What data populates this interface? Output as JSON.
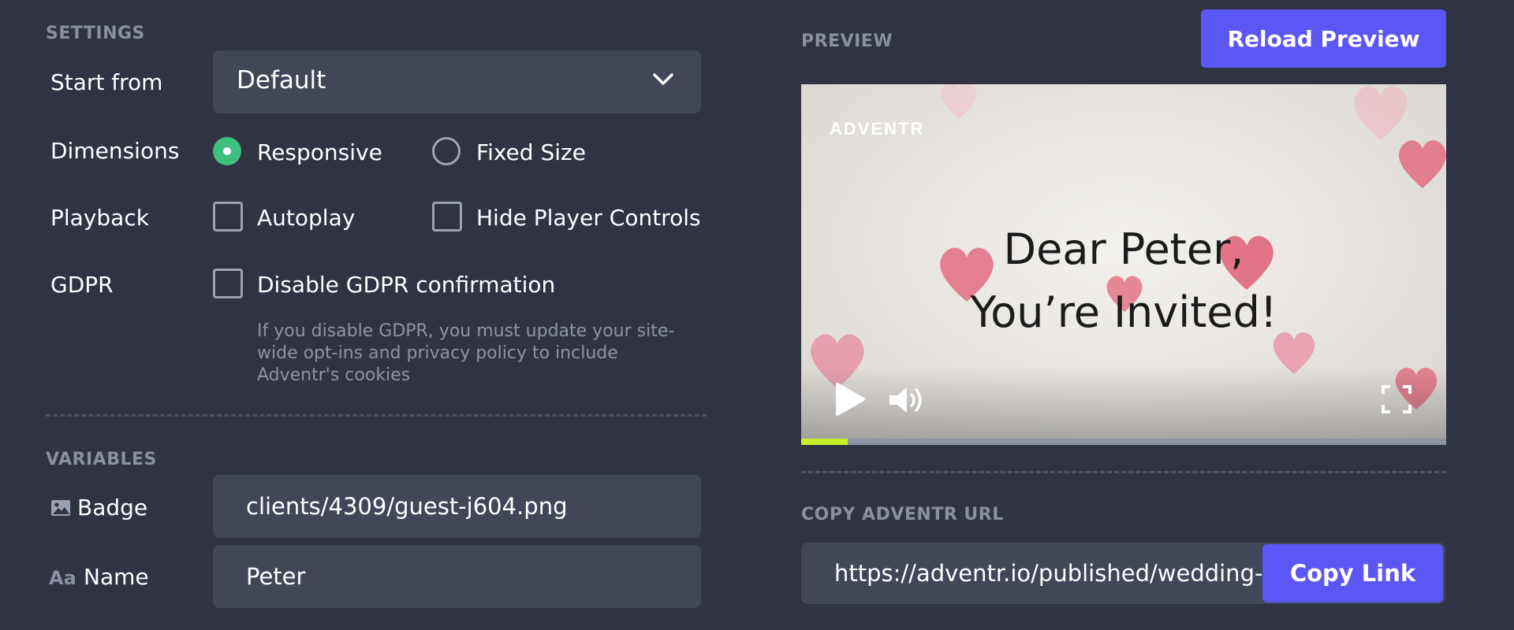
{
  "settings": {
    "title": "SETTINGS",
    "start_from": {
      "label": "Start from",
      "value": "Default"
    },
    "dimensions": {
      "label": "Dimensions",
      "options": [
        {
          "label": "Responsive",
          "selected": true
        },
        {
          "label": "Fixed Size",
          "selected": false
        }
      ]
    },
    "playback": {
      "label": "Playback",
      "options": [
        {
          "label": "Autoplay",
          "checked": false
        },
        {
          "label": "Hide Player Controls",
          "checked": false
        }
      ]
    },
    "gdpr": {
      "label": "GDPR",
      "option": {
        "label": "Disable GDPR confirmation",
        "checked": false
      },
      "note_lines": [
        "If you disable GDPR, you must update your site-",
        "wide opt-ins and privacy policy to include",
        "Adventr's cookies"
      ]
    }
  },
  "variables": {
    "title": "VARIABLES",
    "items": [
      {
        "icon": "image-icon",
        "label": "Badge",
        "value": "clients/4309/guest-j604.png"
      },
      {
        "icon": "text-type-icon",
        "icon_text": "Aa",
        "label": "Name",
        "value": "Peter"
      }
    ]
  },
  "preview": {
    "title": "PREVIEW",
    "reload_button": "Reload Preview",
    "video": {
      "logo": "ADVENTR",
      "line1": "Dear Peter,",
      "line2": "You’re Invited!",
      "progress": 0.072
    }
  },
  "copy_url": {
    "title": "COPY ADVENTR URL",
    "url": "https://adventr.io/published/wedding-invite",
    "button": "Copy Link"
  },
  "colors": {
    "background": "#2f3342",
    "field": "#414659",
    "accent": "#5b57f5",
    "radio_selected": "#3fbf7f",
    "progress": "#c8f02a"
  }
}
